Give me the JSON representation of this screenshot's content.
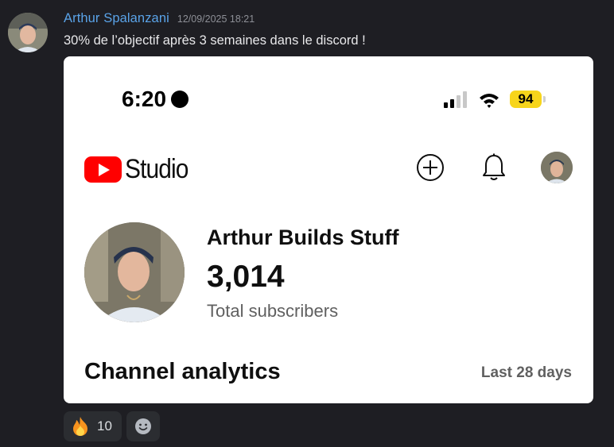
{
  "message": {
    "author": "Arthur Spalanzani",
    "timestamp": "12/09/2025 18:21",
    "text": "30% de l’objectif après 3 semaines dans le discord !",
    "author_color": "#5aa3e8"
  },
  "screenshot": {
    "status_bar": {
      "time": "6:20",
      "battery": "94",
      "battery_color": "#f7d51b"
    },
    "header": {
      "logo_text": "Studio",
      "icons": [
        "create-icon",
        "notifications-bell-icon",
        "account-avatar"
      ]
    },
    "channel": {
      "name": "Arthur Builds Stuff",
      "subscribers": "3,014",
      "subscribers_label": "Total subscribers"
    },
    "analytics": {
      "title": "Channel analytics",
      "range": "Last 28 days"
    },
    "brand_color": "#ff0000"
  },
  "reactions": [
    {
      "emoji": "fire-emoji",
      "count": "10"
    }
  ],
  "add_reaction_icon": "smiley-add-reaction-icon"
}
